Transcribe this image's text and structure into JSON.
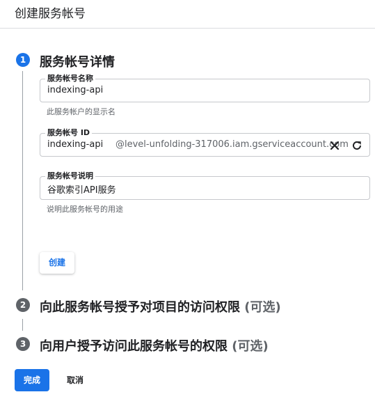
{
  "header": {
    "title": "创建服务帐号"
  },
  "steps": [
    {
      "number": "1",
      "title": "服务帐号详情",
      "optional": ""
    },
    {
      "number": "2",
      "title": "向此服务帐号授予对项目的访问权限",
      "optional": "(可选)"
    },
    {
      "number": "3",
      "title": "向用户授予访问此服务帐号的权限",
      "optional": "(可选)"
    }
  ],
  "form": {
    "name": {
      "label": "服务帐号名称",
      "value": "indexing-api",
      "hint": "此服务帐户的显示名"
    },
    "id": {
      "label": "服务帐号 ID",
      "value": "indexing-api",
      "suffix": "@level-unfolding-317006.iam.gserviceaccount.com"
    },
    "description": {
      "label": "服务帐号说明",
      "value": "谷歌索引API服务",
      "hint": "说明此服务帐号的用途"
    },
    "create_label": "创建"
  },
  "footer": {
    "done_label": "完成",
    "cancel_label": "取消"
  },
  "colors": {
    "accent": "#1a73e8",
    "inactive_step": "#5f6368",
    "border": "#c6c8cc"
  },
  "icons": {
    "clear": "close-icon",
    "refresh": "refresh-icon"
  }
}
